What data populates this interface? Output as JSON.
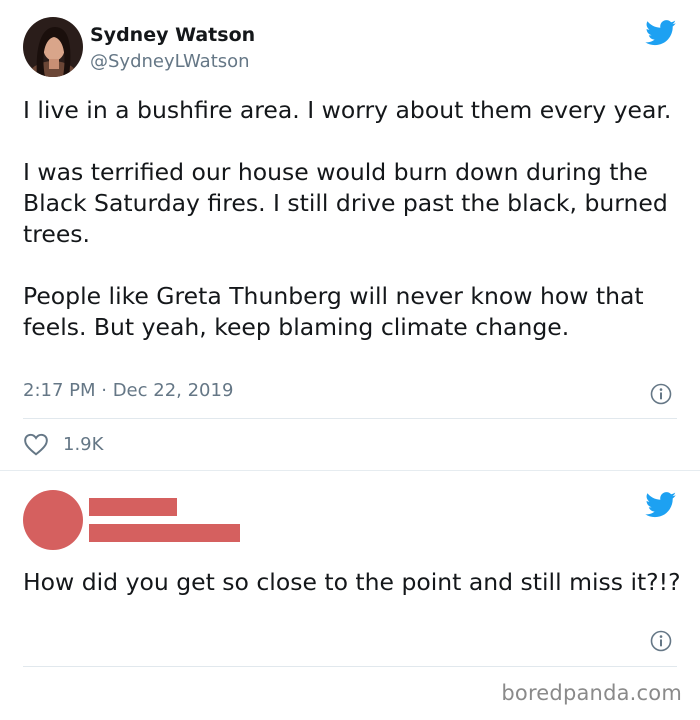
{
  "tweet1": {
    "author_name": "Sydney Watson",
    "author_handle": "@SydneyLWatson",
    "paragraphs": [
      "I live in a bushfire area. I worry about them every year.",
      "I was terrified our house would burn down during the Black Saturday fires. I still drive past the black, burned trees.",
      "People like Greta Thunberg will never know how that feels. But yeah, keep blaming climate change."
    ],
    "timestamp": "2:17 PM · Dec 22, 2019",
    "like_count": "1.9K"
  },
  "tweet2": {
    "text": "How did you get so close to the point and still miss it?!?",
    "redaction_color": "#d5605f"
  },
  "colors": {
    "twitter_blue": "#1da1f2",
    "secondary_text": "#657786",
    "divider": "#e1e8ed"
  },
  "icons": [
    "twitter-bird-icon",
    "info-icon",
    "heart-icon"
  ],
  "watermark": "boredpanda.com"
}
